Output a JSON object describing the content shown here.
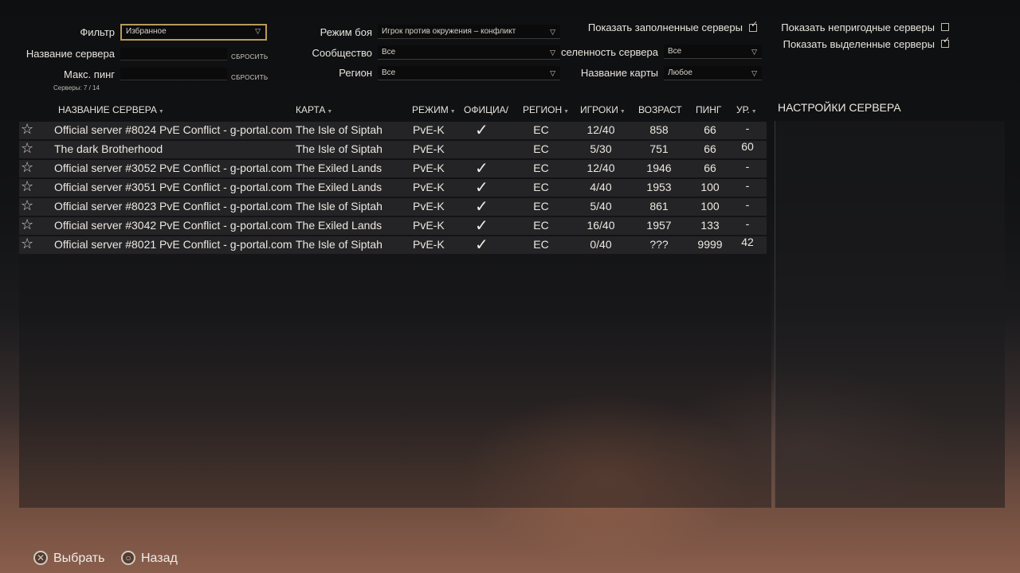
{
  "filters": {
    "filter_label": "Фильтр",
    "filter_value": "Избранное",
    "server_name_label": "Название сервера",
    "server_name_value": "",
    "reset_label": "СБРОСИТЬ",
    "max_ping_label": "Макс. пинг",
    "max_ping_value": "",
    "servers_count": "Серверы: 7 / 14",
    "combat_mode_label": "Режим боя",
    "combat_mode_value": "Игрок против окружения – конфликт",
    "community_label": "Сообщество",
    "community_value": "Все",
    "region_label": "Регион",
    "region_value": "Все",
    "population_label": "селенность сервера",
    "population_value": "Все",
    "map_name_label": "Название карты",
    "map_name_value": "Любое",
    "show_full_label": "Показать заполненные серверы",
    "show_full_checked": true,
    "show_invalid_label": "Показать непригодные серверы",
    "show_invalid_checked": false,
    "show_highlighted_label": "Показать выделенные серверы",
    "show_highlighted_checked": true
  },
  "table": {
    "columns": {
      "name": "НАЗВАНИЕ СЕРВЕРА",
      "map": "КАРТА",
      "mode": "РЕЖИМ",
      "official": "ОФИЦИА/",
      "region": "РЕГИОН",
      "players": "ИГРОКИ",
      "age": "ВОЗРАСТ",
      "ping": "ПИНГ",
      "level": "УР."
    },
    "rows": [
      {
        "name": "Official server #8024 PvE Conflict - g-portal.com",
        "map": "The Isle of Siptah",
        "mode": "PvE-K",
        "official": true,
        "region": "ЕС",
        "players": "12/40",
        "age": "858",
        "ping": "66",
        "level": "-"
      },
      {
        "name": "The dark Brotherhood",
        "map": "The Isle of Siptah",
        "mode": "PvE-K",
        "official": false,
        "region": "ЕС",
        "players": "5/30",
        "age": "751",
        "ping": "66",
        "level": "60"
      },
      {
        "name": "Official server #3052 PvE Conflict - g-portal.com",
        "map": "The Exiled Lands",
        "mode": "PvE-K",
        "official": true,
        "region": "ЕС",
        "players": "12/40",
        "age": "1946",
        "ping": "66",
        "level": "-"
      },
      {
        "name": "Official server #3051 PvE Conflict - g-portal.com",
        "map": "The Exiled Lands",
        "mode": "PvE-K",
        "official": true,
        "region": "ЕС",
        "players": "4/40",
        "age": "1953",
        "ping": "100",
        "level": "-"
      },
      {
        "name": "Official server #8023 PvE Conflict - g-portal.com",
        "map": "The Isle of Siptah",
        "mode": "PvE-K",
        "official": true,
        "region": "ЕС",
        "players": "5/40",
        "age": "861",
        "ping": "100",
        "level": "-"
      },
      {
        "name": "Official server #3042 PvE Conflict - g-portal.com",
        "map": "The Exiled Lands",
        "mode": "PvE-K",
        "official": true,
        "region": "ЕС",
        "players": "16/40",
        "age": "1957",
        "ping": "133",
        "level": "-"
      },
      {
        "name": "Official server #8021 PvE Conflict - g-portal.com",
        "map": "The Isle of Siptah",
        "mode": "PvE-K",
        "official": true,
        "region": "ЕС",
        "players": "0/40",
        "age": "???",
        "ping": "9999",
        "level": "42"
      }
    ]
  },
  "server_settings_title": "НАСТРОЙКИ СЕРВЕРА",
  "footer": {
    "select_label": "Выбрать",
    "back_label": "Назад"
  },
  "icons": {
    "star": "star-icon",
    "check": "check-icon",
    "cross_button": "cross-button-icon",
    "circle_button": "circle-button-icon"
  }
}
